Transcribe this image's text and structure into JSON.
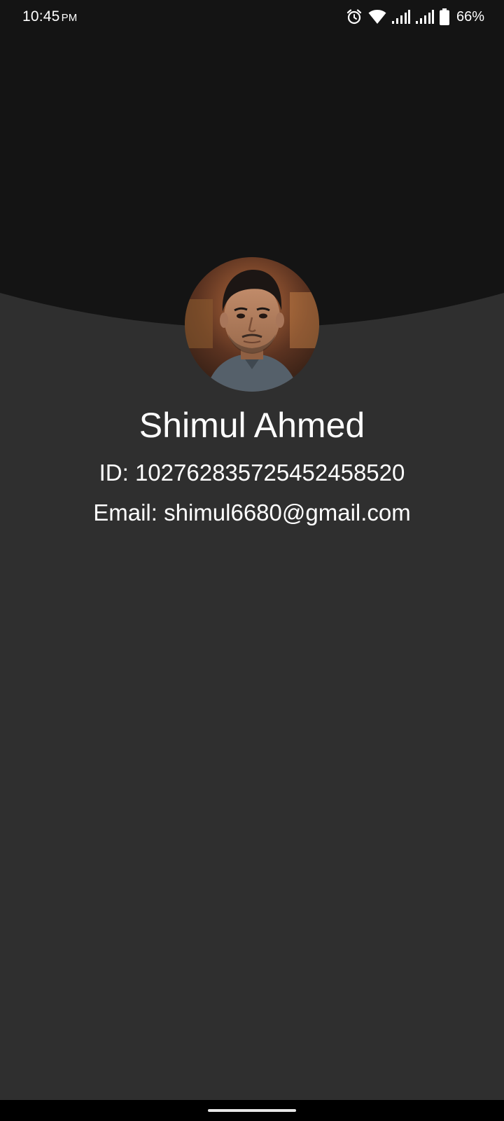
{
  "status_bar": {
    "time": "10:45",
    "ampm": "PM",
    "battery_percent": "66%",
    "icons": [
      "alarm-icon",
      "wifi-icon",
      "signal-icon",
      "signal-icon",
      "battery-icon"
    ]
  },
  "profile": {
    "name": "Shimul Ahmed",
    "id_text": "ID: 102762835725452458520",
    "email_text": "Email: shimul6680@gmail.com"
  },
  "colors": {
    "header_background": "#141414",
    "page_background": "#2f2f2f",
    "text": "#ffffff"
  }
}
